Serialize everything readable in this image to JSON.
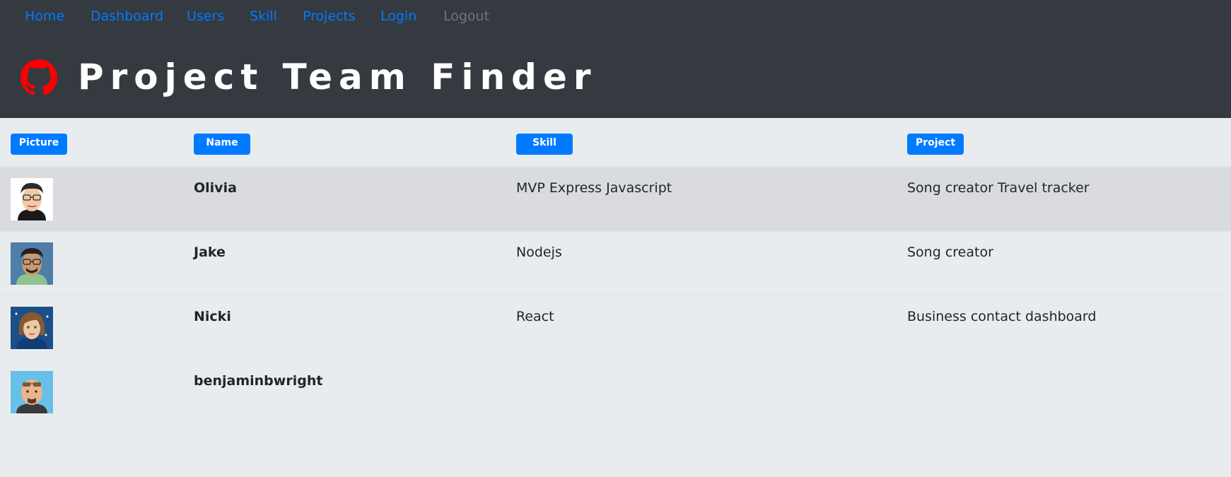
{
  "nav": {
    "items": [
      {
        "label": "Home"
      },
      {
        "label": "Dashboard"
      },
      {
        "label": "Users"
      },
      {
        "label": "Skill"
      },
      {
        "label": "Projects"
      },
      {
        "label": "Login"
      },
      {
        "label": "Logout"
      }
    ]
  },
  "header": {
    "title": "Project Team Finder",
    "logo_icon": "github-octocat-icon",
    "logo_color": "#ff0000"
  },
  "table": {
    "columns": [
      "Picture",
      "Name",
      "Skill",
      "Project"
    ],
    "rows": [
      {
        "name": "Olivia",
        "skill": "MVP Express Javascript",
        "project": "Song creator Travel tracker",
        "avatar_icon": "avatar-man-glasses-icon"
      },
      {
        "name": "Jake",
        "skill": "Nodejs",
        "project": "Song creator",
        "avatar_icon": "avatar-man-glasses-green-shirt-icon"
      },
      {
        "name": "Nicki",
        "skill": "React",
        "project": "Business contact dashboard",
        "avatar_icon": "avatar-woman-brown-hair-icon"
      },
      {
        "name": "benjaminbwright",
        "skill": "",
        "project": "",
        "avatar_icon": "avatar-bald-man-sunglasses-icon"
      }
    ]
  },
  "colors": {
    "primary": "#007bff",
    "muted": "#6c757d",
    "header_bg": "#343a40",
    "page_bg": "#e9ecef"
  }
}
